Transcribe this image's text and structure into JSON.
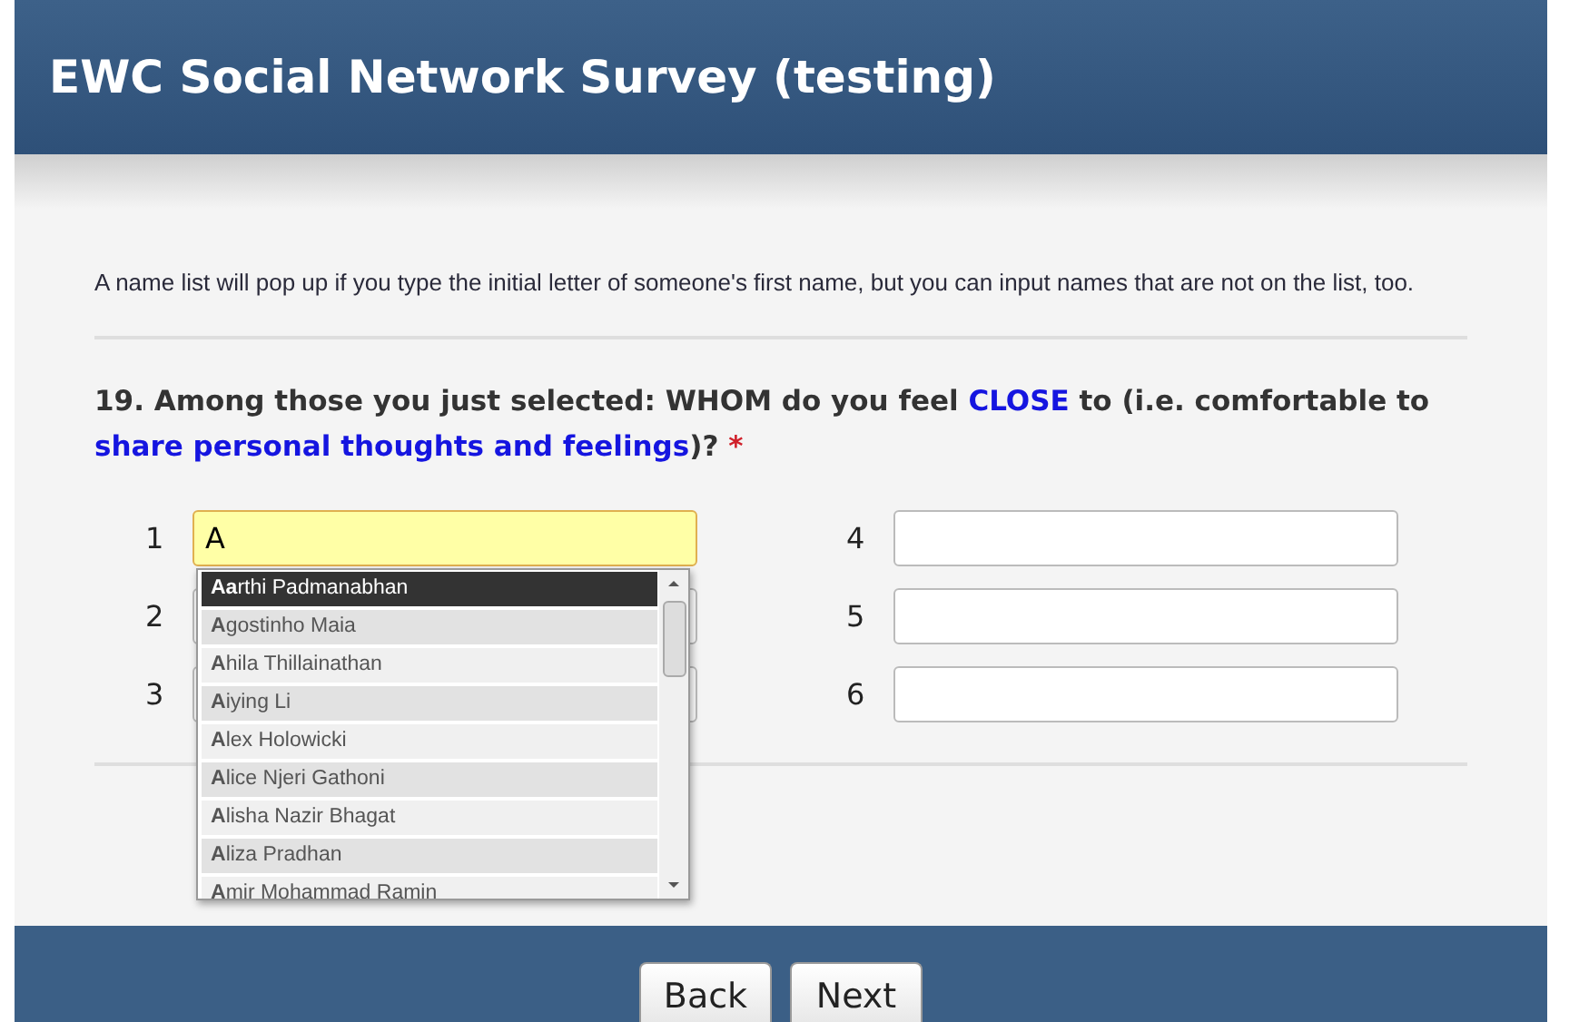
{
  "header": {
    "title": "EWC Social Network Survey (testing)"
  },
  "intro": "A name list will pop up if you type the initial letter of someone's first name, but you can input names that are not on the list, too.",
  "question": {
    "segments": [
      {
        "text": "19. Among those you just selected: WHOM do you feel ",
        "highlight": false
      },
      {
        "text": "CLOSE",
        "highlight": true
      },
      {
        "text": " to (i.e. comfortable to ",
        "highlight": false
      },
      {
        "text": "share personal thoughts and feelings",
        "highlight": true
      },
      {
        "text": ")?",
        "highlight": false
      }
    ],
    "required_mark": "*"
  },
  "fields": [
    {
      "number": "1",
      "value": "A",
      "focused": true
    },
    {
      "number": "4",
      "focused": false
    },
    {
      "number": "2",
      "focused": false
    },
    {
      "number": "5",
      "focused": false
    },
    {
      "number": "3",
      "focused": false
    },
    {
      "number": "6",
      "focused": false
    }
  ],
  "suggestions": [
    {
      "name": "**Aa**rthi Padmanabhan",
      "selected": true
    },
    {
      "name": "**A**gostinho Maia",
      "selected": false
    },
    {
      "name": "**A**hila Thillainathan",
      "selected": false
    },
    {
      "name": "**A**iying Li",
      "selected": false
    },
    {
      "name": "**A**lex Holowicki",
      "selected": false
    },
    {
      "name": "**A**lice Njeri Gathoni",
      "selected": false
    },
    {
      "name": "**A**lisha Nazir Bhagat",
      "selected": false
    },
    {
      "name": "**A**liza Pradhan",
      "selected": false
    },
    {
      "name": "**A**mir Mohammad Ramin",
      "selected": false
    }
  ],
  "buttons": [
    "Back",
    "Next"
  ]
}
